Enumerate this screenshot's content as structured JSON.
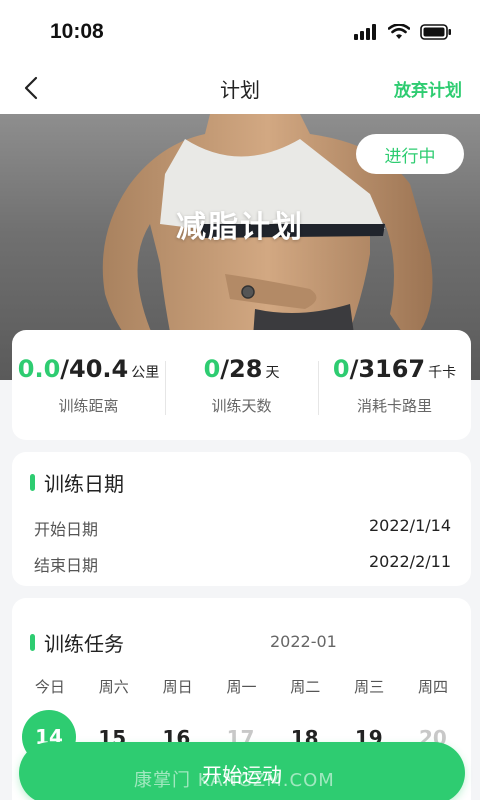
{
  "status_bar": {
    "time": "10:08"
  },
  "nav": {
    "title": "计划",
    "abandon_label": "放弃计划"
  },
  "hero": {
    "title": "减脂计划",
    "status_label": "进行中"
  },
  "stats": [
    {
      "current": "0.0",
      "total": "/40.4",
      "unit": "公里",
      "label": "训练距离"
    },
    {
      "current": "0",
      "total": "/28",
      "unit": "天",
      "label": "训练天数"
    },
    {
      "current": "0",
      "total": "/3167",
      "unit": "千卡",
      "label": "消耗卡路里"
    }
  ],
  "dates": {
    "title": "训练日期",
    "start_label": "开始日期",
    "start_value": "2022/1/14",
    "end_label": "结束日期",
    "end_value": "2022/2/11"
  },
  "tasks": {
    "title": "训练任务",
    "month": "2022-01",
    "weekdays": [
      "今日",
      "周六",
      "周日",
      "周一",
      "周二",
      "周三",
      "周四"
    ],
    "days": [
      "14",
      "15",
      "16",
      "17",
      "18",
      "19",
      "20"
    ]
  },
  "start_button": "开始运动",
  "watermark": "康掌门 KANGZM.COM",
  "colors": {
    "accent": "#2ecc71"
  },
  "icons": [
    "signal-icon",
    "wifi-icon",
    "battery-icon",
    "back-arrow-icon"
  ]
}
